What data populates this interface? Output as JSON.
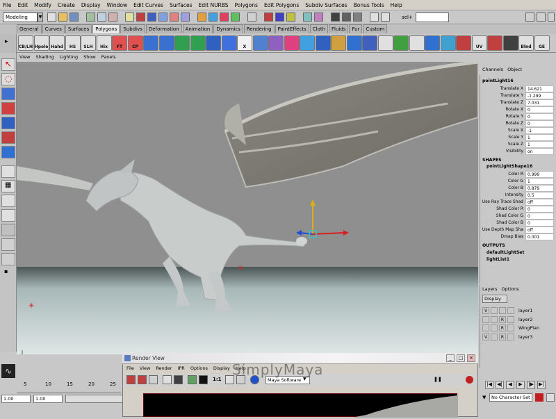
{
  "menubar": [
    "File",
    "Edit",
    "Modify",
    "Create",
    "Display",
    "Window",
    "Edit Curves",
    "Surfaces",
    "Edit NURBS",
    "Polygons",
    "Edit Polygons",
    "Subdiv Surfaces",
    "Bonus Tools",
    "Help"
  ],
  "status": {
    "mode": "Modeling",
    "sel_label": "sel+"
  },
  "shelf_tabs": [
    "General",
    "Curves",
    "Surfaces",
    "Polygons",
    "Subdivs",
    "Deformation",
    "Animation",
    "Dynamics",
    "Rendering",
    "PaintEffects",
    "Cloth",
    "Fluids",
    "Fur",
    "Custom"
  ],
  "shelf_active": "Polygons",
  "shelf_icons": [
    "CB/LH",
    "Hpole",
    "Hahd",
    "HS",
    "SLH",
    "Hix",
    "FT",
    "CP",
    "",
    "",
    "",
    "",
    "",
    "",
    "X",
    "",
    "",
    "",
    "",
    "",
    "",
    "",
    "",
    "",
    "",
    "",
    "",
    "",
    "",
    "UV",
    "",
    "",
    "Blnd",
    "GE"
  ],
  "viewport_menu": [
    "View",
    "Shading",
    "Lighting",
    "Show",
    "Panels"
  ],
  "channel_box": {
    "menu": [
      "Channels",
      "Object"
    ],
    "node": "pointLight16",
    "attrs": [
      {
        "label": "Translate X",
        "value": "14.621"
      },
      {
        "label": "Translate Y",
        "value": "-1.299"
      },
      {
        "label": "Translate Z",
        "value": "7.031"
      },
      {
        "label": "Rotate X",
        "value": "0"
      },
      {
        "label": "Rotate Y",
        "value": "0"
      },
      {
        "label": "Rotate Z",
        "value": "0"
      },
      {
        "label": "Scale X",
        "value": "-1"
      },
      {
        "label": "Scale Y",
        "value": "1"
      },
      {
        "label": "Scale Z",
        "value": "1"
      },
      {
        "label": "Visibility",
        "value": "on"
      }
    ],
    "shapes_header": "SHAPES",
    "shape_node": "pointLightShape16",
    "shape_attrs": [
      {
        "label": "Color R",
        "value": "0.999"
      },
      {
        "label": "Color G",
        "value": "1"
      },
      {
        "label": "Color B",
        "value": "0.879"
      },
      {
        "label": "Intensity",
        "value": "0.5"
      },
      {
        "label": "Use Ray Trace Shad",
        "value": "off"
      },
      {
        "label": "Shad Color R",
        "value": "0"
      },
      {
        "label": "Shad Color G",
        "value": "0"
      },
      {
        "label": "Shad Color B",
        "value": "0"
      },
      {
        "label": "Use Depth Map Sha",
        "value": "off"
      },
      {
        "label": "Dmap Bias",
        "value": "0.001"
      }
    ],
    "outputs_header": "OUTPUTS",
    "outputs": [
      "defaultLightSet",
      "lightList1"
    ]
  },
  "layers": {
    "menu": [
      "Layers",
      "Options"
    ],
    "display": "Display",
    "rows": [
      {
        "v": "V",
        "r": "",
        "name": "layer1"
      },
      {
        "v": "",
        "r": "R",
        "name": "layer2"
      },
      {
        "v": "",
        "r": "R",
        "name": "WingPlan"
      },
      {
        "v": "V",
        "r": "R",
        "name": "layer3"
      }
    ]
  },
  "timeline": {
    "ticks": [
      "5",
      "10",
      "15",
      "20",
      "25"
    ],
    "start": "1.00",
    "current": "1.00"
  },
  "render_view": {
    "title": "Render View",
    "menu": [
      "File",
      "View",
      "Render",
      "IPR",
      "Options",
      "Display",
      "Help"
    ],
    "ratio": "1:1",
    "renderer": "Maya Software"
  },
  "watermark": "SimplyMaya",
  "character_set": "No Character Set",
  "colors": {
    "accent_blue": "#1a4fa0",
    "light_icon_yellow": "#d9b018",
    "manip_red": "#d82020",
    "manip_blue": "#2050d0"
  }
}
